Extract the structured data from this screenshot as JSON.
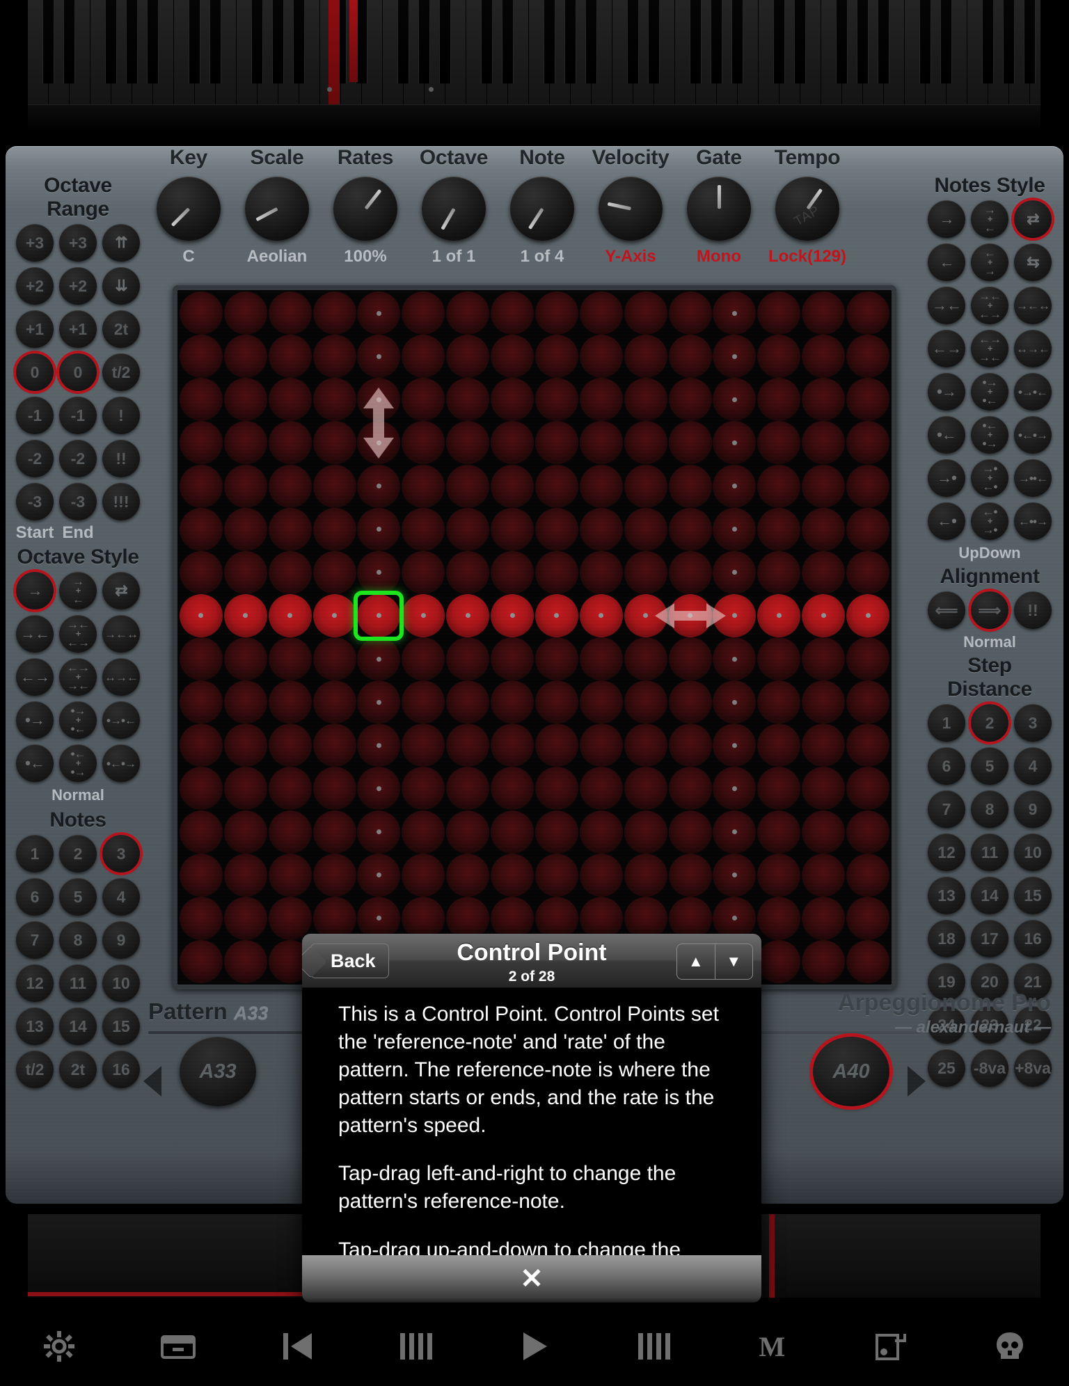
{
  "app": {
    "brand_name": "Arpeggionome Pro",
    "brand_author": "— alexandernaut —",
    "pattern_label": "Pattern",
    "pattern_value": "A33"
  },
  "knobs": [
    {
      "name": "Key",
      "value": "C",
      "red": false,
      "angle": -135
    },
    {
      "name": "Scale",
      "value": "Aeolian",
      "red": false,
      "angle": -118
    },
    {
      "name": "Rates",
      "value": "100%",
      "red": false,
      "angle": 38
    },
    {
      "name": "Octave",
      "value": "1 of 1",
      "red": false,
      "angle": -150
    },
    {
      "name": "Note",
      "value": "1 of 4",
      "red": false,
      "angle": -147
    },
    {
      "name": "Velocity",
      "value": "Y-Axis",
      "red": true,
      "angle": -78
    },
    {
      "name": "Gate",
      "value": "Mono",
      "red": true,
      "angle": 0
    },
    {
      "name": "Tempo",
      "value": "Lock(129)",
      "red": true,
      "angle": 35,
      "overlay": "TAP"
    }
  ],
  "left_panel": {
    "octave_range": {
      "title": "Octave Range",
      "labels": [
        "Start",
        "End"
      ],
      "rows": [
        [
          "+3",
          "+3",
          "⇈"
        ],
        [
          "+2",
          "+2",
          "⇊"
        ],
        [
          "+1",
          "+1",
          "2t"
        ],
        [
          "0",
          "0",
          "t/2"
        ],
        [
          "-1",
          "-1",
          "!"
        ],
        [
          "-2",
          "-2",
          "!!"
        ],
        [
          "-3",
          "-3",
          "!!!"
        ]
      ],
      "selected": [
        [
          3,
          0
        ],
        [
          3,
          1
        ]
      ]
    },
    "octave_style": {
      "title": "Octave Style",
      "sub": "Normal",
      "rows": [
        [
          "→",
          "→|←",
          "⇄"
        ],
        [
          "→←",
          "→←|←→",
          "→←↔"
        ],
        [
          "←→",
          "←→|→←",
          "↔→←"
        ],
        [
          "•→",
          "•→|•←",
          "•→•←"
        ],
        [
          "•←",
          "•←|•→",
          "•←•→"
        ]
      ],
      "selected": [
        [
          0,
          0
        ]
      ]
    },
    "notes": {
      "title": "Notes",
      "rows": [
        [
          "1",
          "2",
          "3"
        ],
        [
          "6",
          "5",
          "4"
        ],
        [
          "7",
          "8",
          "9"
        ],
        [
          "12",
          "11",
          "10"
        ],
        [
          "13",
          "14",
          "15"
        ],
        [
          "t/2",
          "2t",
          "16"
        ]
      ],
      "selected": [
        [
          0,
          2
        ]
      ]
    }
  },
  "right_panel": {
    "notes_style": {
      "title": "Notes Style",
      "sub": "UpDown",
      "rows": [
        [
          "→",
          "→|←",
          "⇄"
        ],
        [
          "←",
          "←|→",
          "⇆"
        ],
        [
          "→←",
          "→←|←→",
          "→←↔"
        ],
        [
          "←→",
          "←→|→←",
          "↔→←"
        ],
        [
          "•→",
          "•→|•←",
          "•→•←"
        ],
        [
          "•←",
          "•←|•→",
          "•←•→"
        ],
        [
          "→•",
          "→•|←•",
          "→••←"
        ],
        [
          "←•",
          "←•|→•",
          "←••→"
        ]
      ],
      "selected": [
        [
          0,
          2
        ]
      ]
    },
    "alignment": {
      "title": "Alignment",
      "sub": "Normal",
      "buttons": [
        "⟸",
        "⟹",
        "!!"
      ],
      "selected": 1
    },
    "step_distance": {
      "title": "Step Distance",
      "rows": [
        [
          "1",
          "2",
          "3"
        ],
        [
          "6",
          "5",
          "4"
        ],
        [
          "7",
          "8",
          "9"
        ],
        [
          "12",
          "11",
          "10"
        ],
        [
          "13",
          "14",
          "15"
        ],
        [
          "18",
          "17",
          "16"
        ],
        [
          "19",
          "20",
          "21"
        ],
        [
          "24",
          "23",
          "22"
        ],
        [
          "25",
          "-8va",
          "+8va"
        ]
      ],
      "selected": [
        [
          0,
          1
        ]
      ]
    }
  },
  "grid": {
    "columns": 16,
    "rows": 16,
    "highlight_column": 4,
    "highlight_row": 7,
    "selected_cell": {
      "col": 4,
      "row": 7
    },
    "note_buttons": {
      "left": "A33",
      "right": "A40"
    }
  },
  "modal": {
    "back_label": "Back",
    "title": "Control Point",
    "count": "2 of 28",
    "up_icon": "▲",
    "down_icon": "▼",
    "close_icon": "✕",
    "paragraphs": [
      "This is a Control Point.  Control Points set the 'reference-note' and 'rate' of the pattern. The reference-note is where the pattern starts or ends, and the rate is the pattern's speed.",
      "Tap-drag left-and-right to change the pattern's reference-note.",
      "Tap-drag up-and-down to change the"
    ]
  },
  "toolbar": {
    "items": [
      {
        "name": "settings-icon",
        "glyph": "⚙"
      },
      {
        "name": "save-icon",
        "glyph": "🗄"
      },
      {
        "name": "skip-back-icon",
        "glyph": "⏮"
      },
      {
        "name": "bars-left-icon",
        "glyph": "|||"
      },
      {
        "name": "play-icon",
        "glyph": "▶"
      },
      {
        "name": "bars-right-icon",
        "glyph": "|||"
      },
      {
        "name": "midi-icon",
        "glyph": "M"
      },
      {
        "name": "export-icon",
        "glyph": "⎙"
      },
      {
        "name": "skull-icon",
        "glyph": "☠"
      }
    ]
  },
  "colors": {
    "accent_red": "#b9101a",
    "select_green": "#1ae81a",
    "panel_gray": "#525c62",
    "value_red": "#c3111a"
  }
}
